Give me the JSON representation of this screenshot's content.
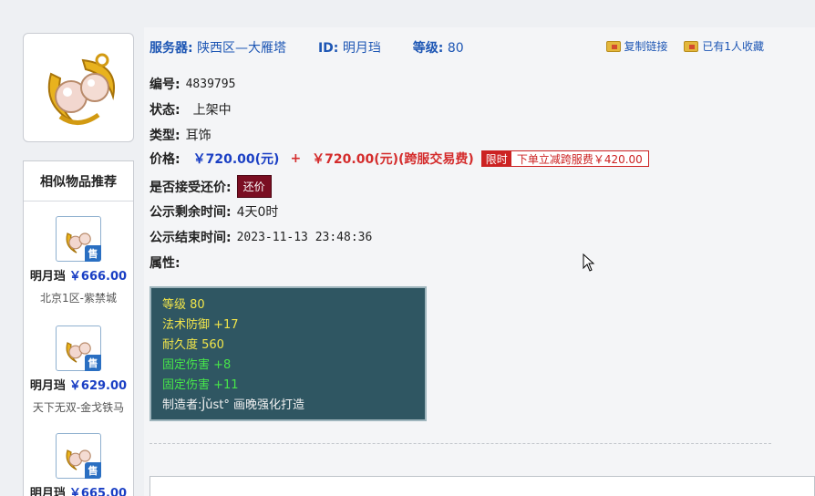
{
  "header": {
    "server_label": "服务器:",
    "server_value": "陕西区—大雁塔",
    "id_label": "ID:",
    "id_value": "明月珰",
    "level_label": "等级:",
    "level_value": "80"
  },
  "actions": {
    "copy_link": "复制链接",
    "favorite": "已有1人收藏"
  },
  "details": {
    "serial_label": "编号:",
    "serial_value": "4839795",
    "status_label": "状态:",
    "status_value": "上架中",
    "type_label": "类型:",
    "type_value": "耳饰",
    "price_label": "价格:",
    "price_value": "￥720.00(元)",
    "price_plus": "+",
    "fee_value": "￥720.00(元)(跨服交易费)",
    "limit_tag": "限时",
    "limit_text": "下单立减跨服费￥420.00",
    "bargain_label": "是否接受还价:",
    "bargain_button": "还价",
    "remaining_label": "公示剩余时间:",
    "remaining_value": "4天0时",
    "end_label": "公示结束时间:",
    "end_value": "2023-11-13 23:48:36",
    "attr_label": "属性:"
  },
  "stats": [
    {
      "text": "等级 80",
      "color": "yellow"
    },
    {
      "text": "法术防御 +17",
      "color": "yellow"
    },
    {
      "text": "耐久度 560",
      "color": "yellow"
    },
    {
      "text": "固定伤害 +8",
      "color": "green"
    },
    {
      "text": "固定伤害 +11",
      "color": "green"
    },
    {
      "text": "制造者:J̌ǔst° 画晚强化打造",
      "color": "white"
    }
  ],
  "sidebar": {
    "title": "相似物品推荐",
    "sale_badge": "售",
    "items": [
      {
        "name": "明月珰",
        "price": "￥666.00",
        "server": "北京1区-紫禁城"
      },
      {
        "name": "明月珰",
        "price": "￥629.00",
        "server": "天下无双-金戈铁马"
      },
      {
        "name": "明月珰",
        "price": "￥665.00",
        "server": ""
      }
    ]
  },
  "colors": {
    "accent_blue": "#1d56b4",
    "price_blue": "#1a3fc4",
    "price_red": "#d42c2c",
    "stat_bg": "#2f5662"
  }
}
